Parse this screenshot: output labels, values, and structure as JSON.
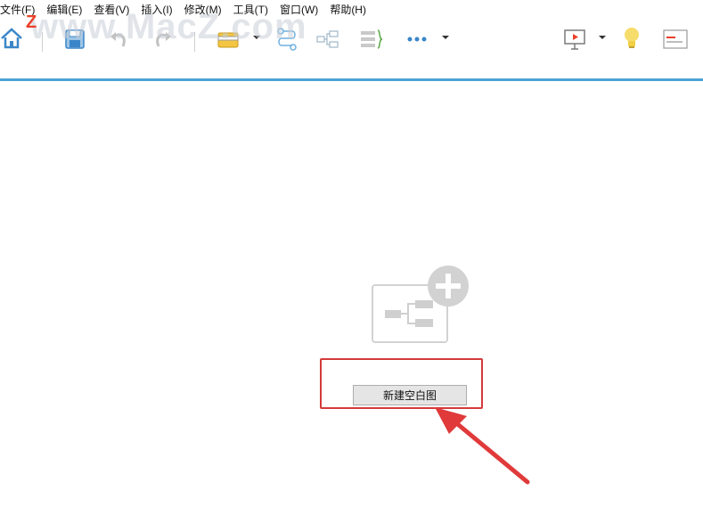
{
  "menu": {
    "items": [
      {
        "label": "文件(F)"
      },
      {
        "label": "编辑(E)"
      },
      {
        "label": "查看(V)"
      },
      {
        "label": "插入(I)"
      },
      {
        "label": "修改(M)"
      },
      {
        "label": "工具(T)"
      },
      {
        "label": "窗口(W)"
      },
      {
        "label": "帮助(H)"
      }
    ]
  },
  "watermark": {
    "text": "www.MacZ.com",
    "logo_letter": "Z"
  },
  "toolbar": {
    "icons": [
      "home-icon",
      "save-icon",
      "undo-icon",
      "redo-icon",
      "folder-icon",
      "dropdown-icon",
      "relationship-icon",
      "subtopic-icon",
      "summary-icon",
      "more-icon",
      "presentation-icon",
      "idea-icon",
      "outline-icon"
    ]
  },
  "main": {
    "new_blank_map_label": "新建空白图"
  },
  "colors": {
    "accent": "#4aa3d4",
    "highlight": "#d43a3a",
    "icon_blue": "#3a86c8"
  }
}
